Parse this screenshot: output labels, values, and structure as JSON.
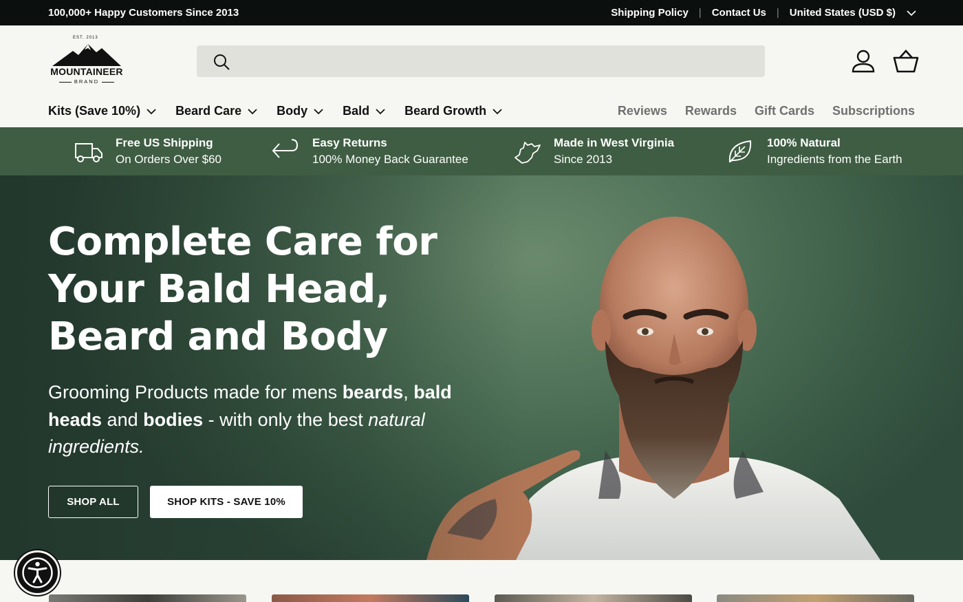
{
  "announcement": {
    "left_text": "100,000+ Happy Customers Since 2013",
    "links": [
      "Shipping Policy",
      "Contact Us"
    ],
    "currency": "United States (USD $)"
  },
  "logo": {
    "est": "EST. 2013",
    "name": "MOUNTAINEER",
    "sub": "BRAND"
  },
  "search": {
    "placeholder": "",
    "value": ""
  },
  "nav": {
    "left": [
      "Kits (Save 10%)",
      "Beard Care",
      "Body",
      "Bald",
      "Beard Growth"
    ],
    "right": [
      "Reviews",
      "Rewards",
      "Gift Cards",
      "Subscriptions"
    ]
  },
  "trust": [
    {
      "icon": "truck-icon",
      "title": "Free US Shipping",
      "subtitle": "On Orders Over $60"
    },
    {
      "icon": "return-arrow-icon",
      "title": "Easy Returns",
      "subtitle": "100% Money Back Guarantee"
    },
    {
      "icon": "west-virginia-icon",
      "title": "Made in West Virginia",
      "subtitle": "Since 2013"
    },
    {
      "icon": "leaf-icon",
      "title": "100% Natural",
      "subtitle": "Ingredients from the Earth"
    }
  ],
  "hero": {
    "heading": "Complete Care for Your Bald Head, Beard and Body",
    "sub_1": "Grooming Products made for mens ",
    "sub_b1": "beards",
    "sub_2": ", ",
    "sub_b2": "bald heads",
    "sub_3": " and ",
    "sub_b3": "bodies",
    "sub_4": " - with only the best ",
    "sub_i1": "natural ingredients.",
    "button_all": "SHOP ALL",
    "button_kits": "SHOP KITS - SAVE 10%"
  },
  "colors": {
    "topbar": "#0b0f0d",
    "trust_bar": "#3e5d43",
    "background": "#f6f6f2",
    "search_bg": "#e1e1dc"
  }
}
